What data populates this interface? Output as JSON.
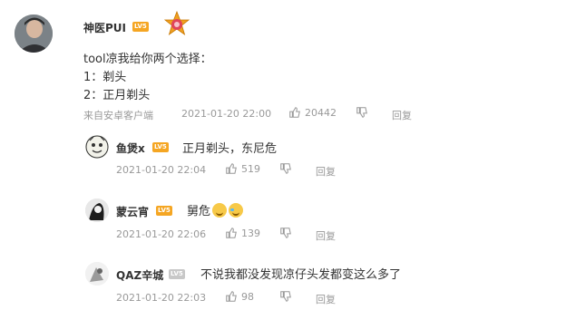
{
  "post": {
    "author": "神医PUI",
    "level": "LV5",
    "content_line1": "tool凉我给你两个选择：",
    "content_line2": "1：剃头",
    "content_line3": "2：正月剃头",
    "source": "来自安卓客户端",
    "timestamp": "2021-01-20 22:00",
    "likes": "20442",
    "reply_label": "回复"
  },
  "replies": [
    {
      "author": "鱼煲x",
      "level": "LV5",
      "text": "正月剃头，东尼危",
      "timestamp": "2021-01-20 22:04",
      "likes": "519",
      "reply_label": "回复"
    },
    {
      "author": "蒙云宵",
      "level": "LV5",
      "text": "舅危",
      "emojis": [
        "grin-icon",
        "teary-laugh-icon"
      ],
      "timestamp": "2021-01-20 22:06",
      "likes": "139",
      "reply_label": "回复"
    },
    {
      "author": "QAZ辛城",
      "level": "LV5",
      "text": "不说我都没发现凉仔头发都变这么多了",
      "timestamp": "2021-01-20 22:03",
      "likes": "98",
      "reply_label": "回复"
    }
  ],
  "colors": {
    "level_badge": "#f5a623",
    "meta_text": "#999999"
  }
}
